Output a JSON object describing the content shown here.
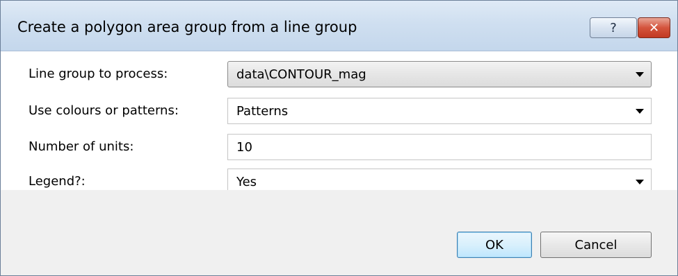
{
  "window": {
    "title": "Create a polygon area group from a line group",
    "help_glyph": "?",
    "close_glyph": "✕"
  },
  "form": {
    "rows": [
      {
        "label": "Line group to process:",
        "value": "data\\CONTOUR_mag",
        "control": "dropdown"
      },
      {
        "label": "Use colours or patterns:",
        "value": "Patterns",
        "control": "dropdown"
      },
      {
        "label": "Number of units:",
        "value": "10",
        "control": "text-input"
      },
      {
        "label": "Legend?:",
        "value": "Yes",
        "control": "dropdown"
      }
    ]
  },
  "buttons": {
    "ok_label": "OK",
    "cancel_label": "Cancel"
  },
  "icons": {
    "help": "help-icon",
    "close": "close-icon",
    "dropdown": "chevron-down-icon"
  }
}
